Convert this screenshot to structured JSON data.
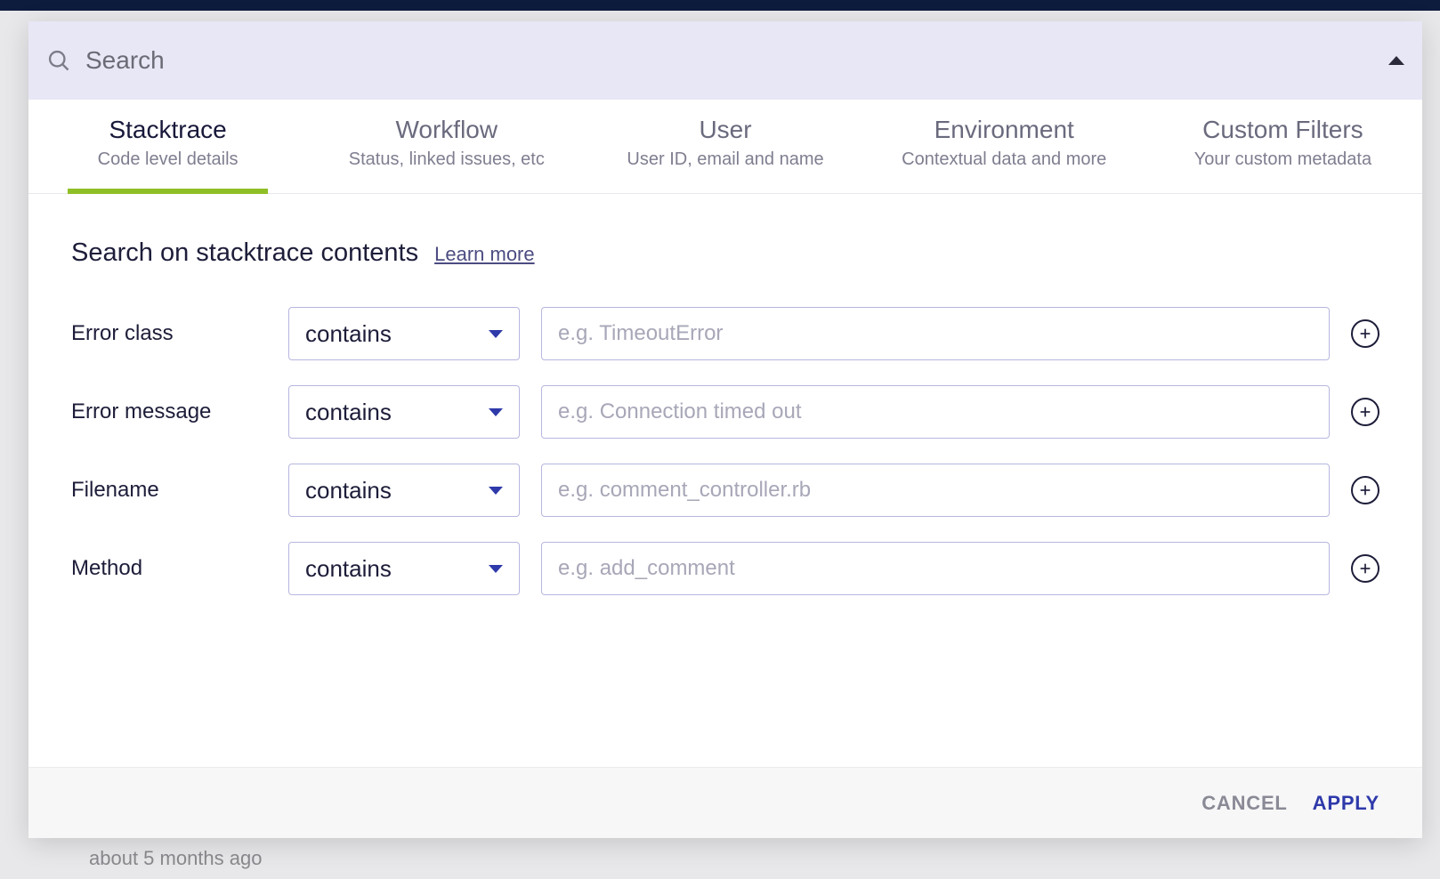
{
  "search": {
    "placeholder": "Search"
  },
  "tabs": [
    {
      "title": "Stacktrace",
      "subtitle": "Code level details",
      "active": true
    },
    {
      "title": "Workflow",
      "subtitle": "Status, linked issues, etc",
      "active": false
    },
    {
      "title": "User",
      "subtitle": "User ID, email and name",
      "active": false
    },
    {
      "title": "Environment",
      "subtitle": "Contextual data and more",
      "active": false
    },
    {
      "title": "Custom Filters",
      "subtitle": "Your custom metadata",
      "active": false
    }
  ],
  "section": {
    "title": "Search on stacktrace contents",
    "learn_more": "Learn more"
  },
  "filters": [
    {
      "label": "Error class",
      "operator": "contains",
      "placeholder": "e.g. TimeoutError"
    },
    {
      "label": "Error message",
      "operator": "contains",
      "placeholder": "e.g. Connection timed out"
    },
    {
      "label": "Filename",
      "operator": "contains",
      "placeholder": "e.g. comment_controller.rb"
    },
    {
      "label": "Method",
      "operator": "contains",
      "placeholder": "e.g. add_comment"
    }
  ],
  "footer": {
    "cancel": "CANCEL",
    "apply": "APPLY"
  },
  "background_text": "about 5 months ago"
}
